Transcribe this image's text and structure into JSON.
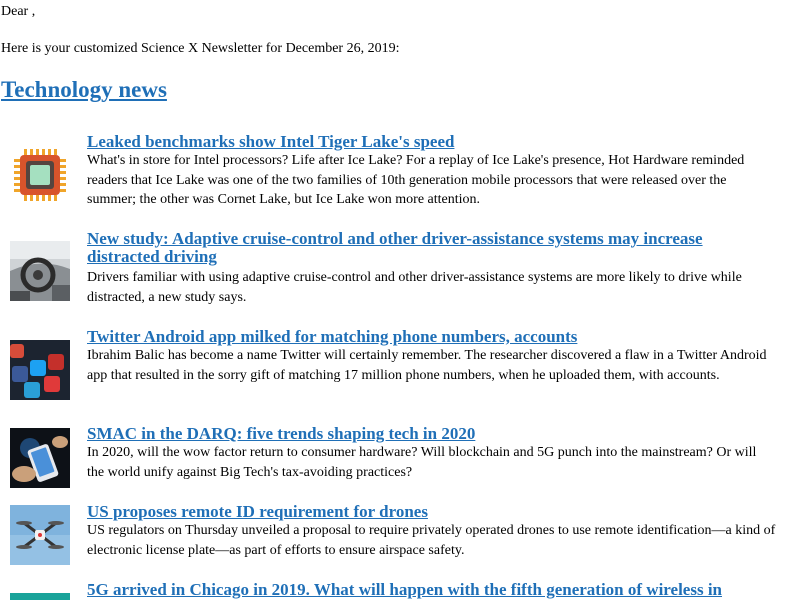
{
  "greeting": "Dear ,",
  "intro": "Here is your customized Science X Newsletter for December 26, 2019:",
  "section_title": "Technology news",
  "articles": [
    {
      "title": "Leaked benchmarks show Intel Tiger Lake's speed",
      "summary": "What's in store for Intel processors? Life after Ice Lake? For a replay of Ice Lake's presence, Hot Hardware reminded readers that Ice Lake was one of the two families of 10th generation mobile processors that were released over the summer; the other was Cornet Lake, but Ice Lake won more attention.",
      "thumbnail": "cpu-chip-icon"
    },
    {
      "title": "New study: Adaptive cruise-control and other driver-assistance systems may increase distracted driving",
      "summary": "Drivers familiar with using adaptive cruise-control and other driver-assistance systems are more likely to drive while distracted, a new study says.",
      "thumbnail": "car-dashboard-photo"
    },
    {
      "title": "Twitter Android app milked for matching phone numbers, accounts",
      "summary": "Ibrahim Balic has become a name Twitter will certainly remember. The researcher discovered a flaw in a Twitter Android app that resulted in the sorry gift of matching 17 million phone numbers, when he uploaded them, with accounts.",
      "thumbnail": "social-app-icons-photo"
    },
    {
      "title": "SMAC in the DARQ: five trends shaping tech in 2020",
      "summary": "In 2020, will the wow factor return to consumer hardware? Will blockchain and 5G punch into the mainstream? Or will the world unify against Big Tech's tax-avoiding practices?",
      "thumbnail": "hand-smartphone-photo"
    },
    {
      "title": "US proposes remote ID requirement for drones",
      "summary": "US regulators on Thursday unveiled a proposal to require privately operated drones to use remote identification—a kind of electronic license plate—as part of efforts to ensure airspace safety.",
      "thumbnail": "drone-photo"
    },
    {
      "title": "5G arrived in Chicago in 2019. What will happen with the fifth generation of wireless in",
      "summary": "",
      "thumbnail": "5g-photo"
    }
  ],
  "colors": {
    "link": "#1f6fb7",
    "text": "#000000",
    "background": "#ffffff"
  }
}
